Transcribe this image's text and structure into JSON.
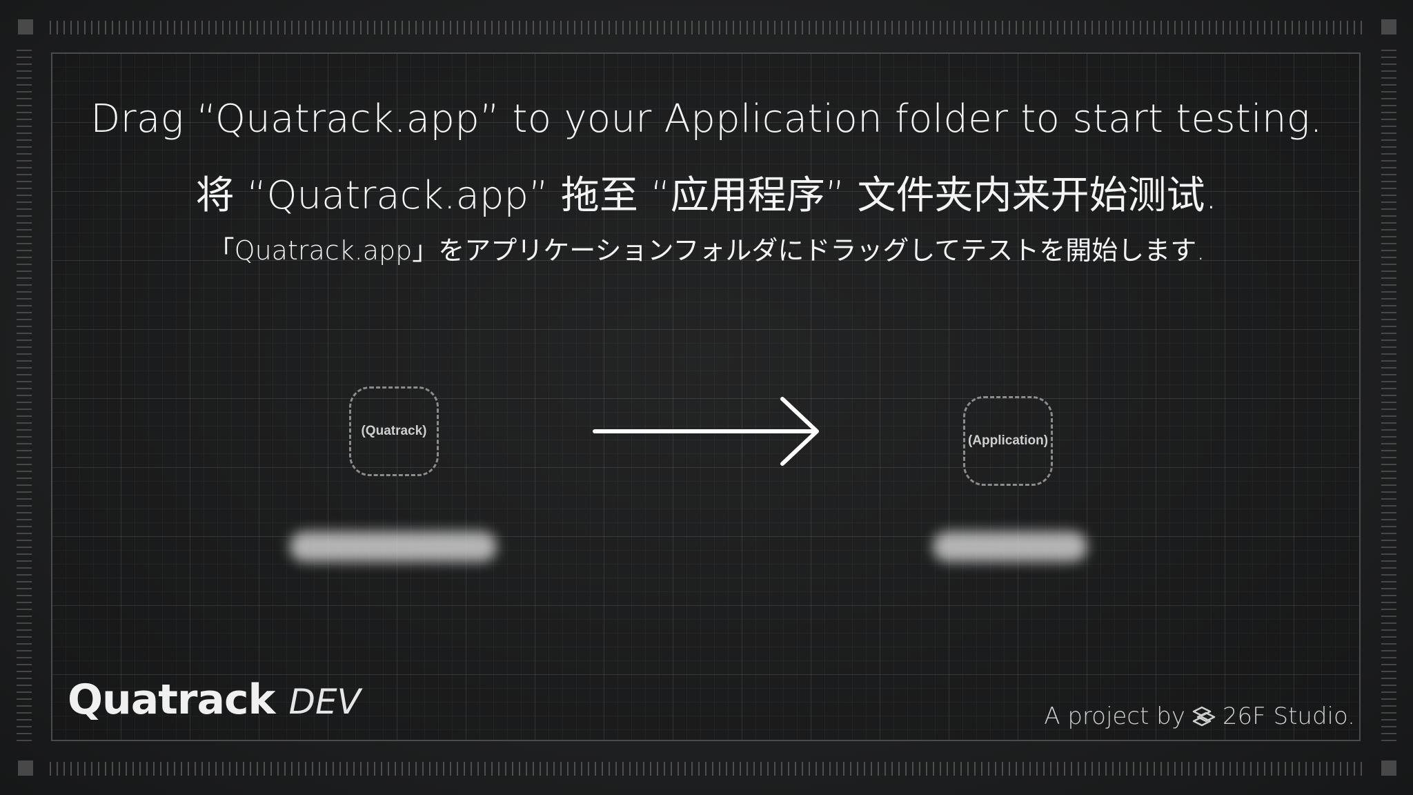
{
  "instructions": {
    "english": "Drag “Quatrack.app” to your Application folder to start testing.",
    "chinese": "将 “Quatrack.app” 拖至 “应用程序” 文件夹内来开始测试.",
    "japanese": "「Quatrack.app」をアプリケーションフォルダにドラッグしてテストを開始します."
  },
  "source_icon": {
    "label": "(Quatrack)"
  },
  "target_icon": {
    "label": "(Application)"
  },
  "brand": {
    "logo": "Quatrack",
    "suffix": "DEV"
  },
  "credit": {
    "prefix": "A project by",
    "studio": "26F Studio."
  },
  "icons": {
    "arrow": "arrow-right-icon",
    "studio_logo": "studio-logo-icon"
  },
  "colors": {
    "background": "#1c1d1e",
    "text": "#f4f4f4",
    "slot_border": "#8c8c8c"
  }
}
